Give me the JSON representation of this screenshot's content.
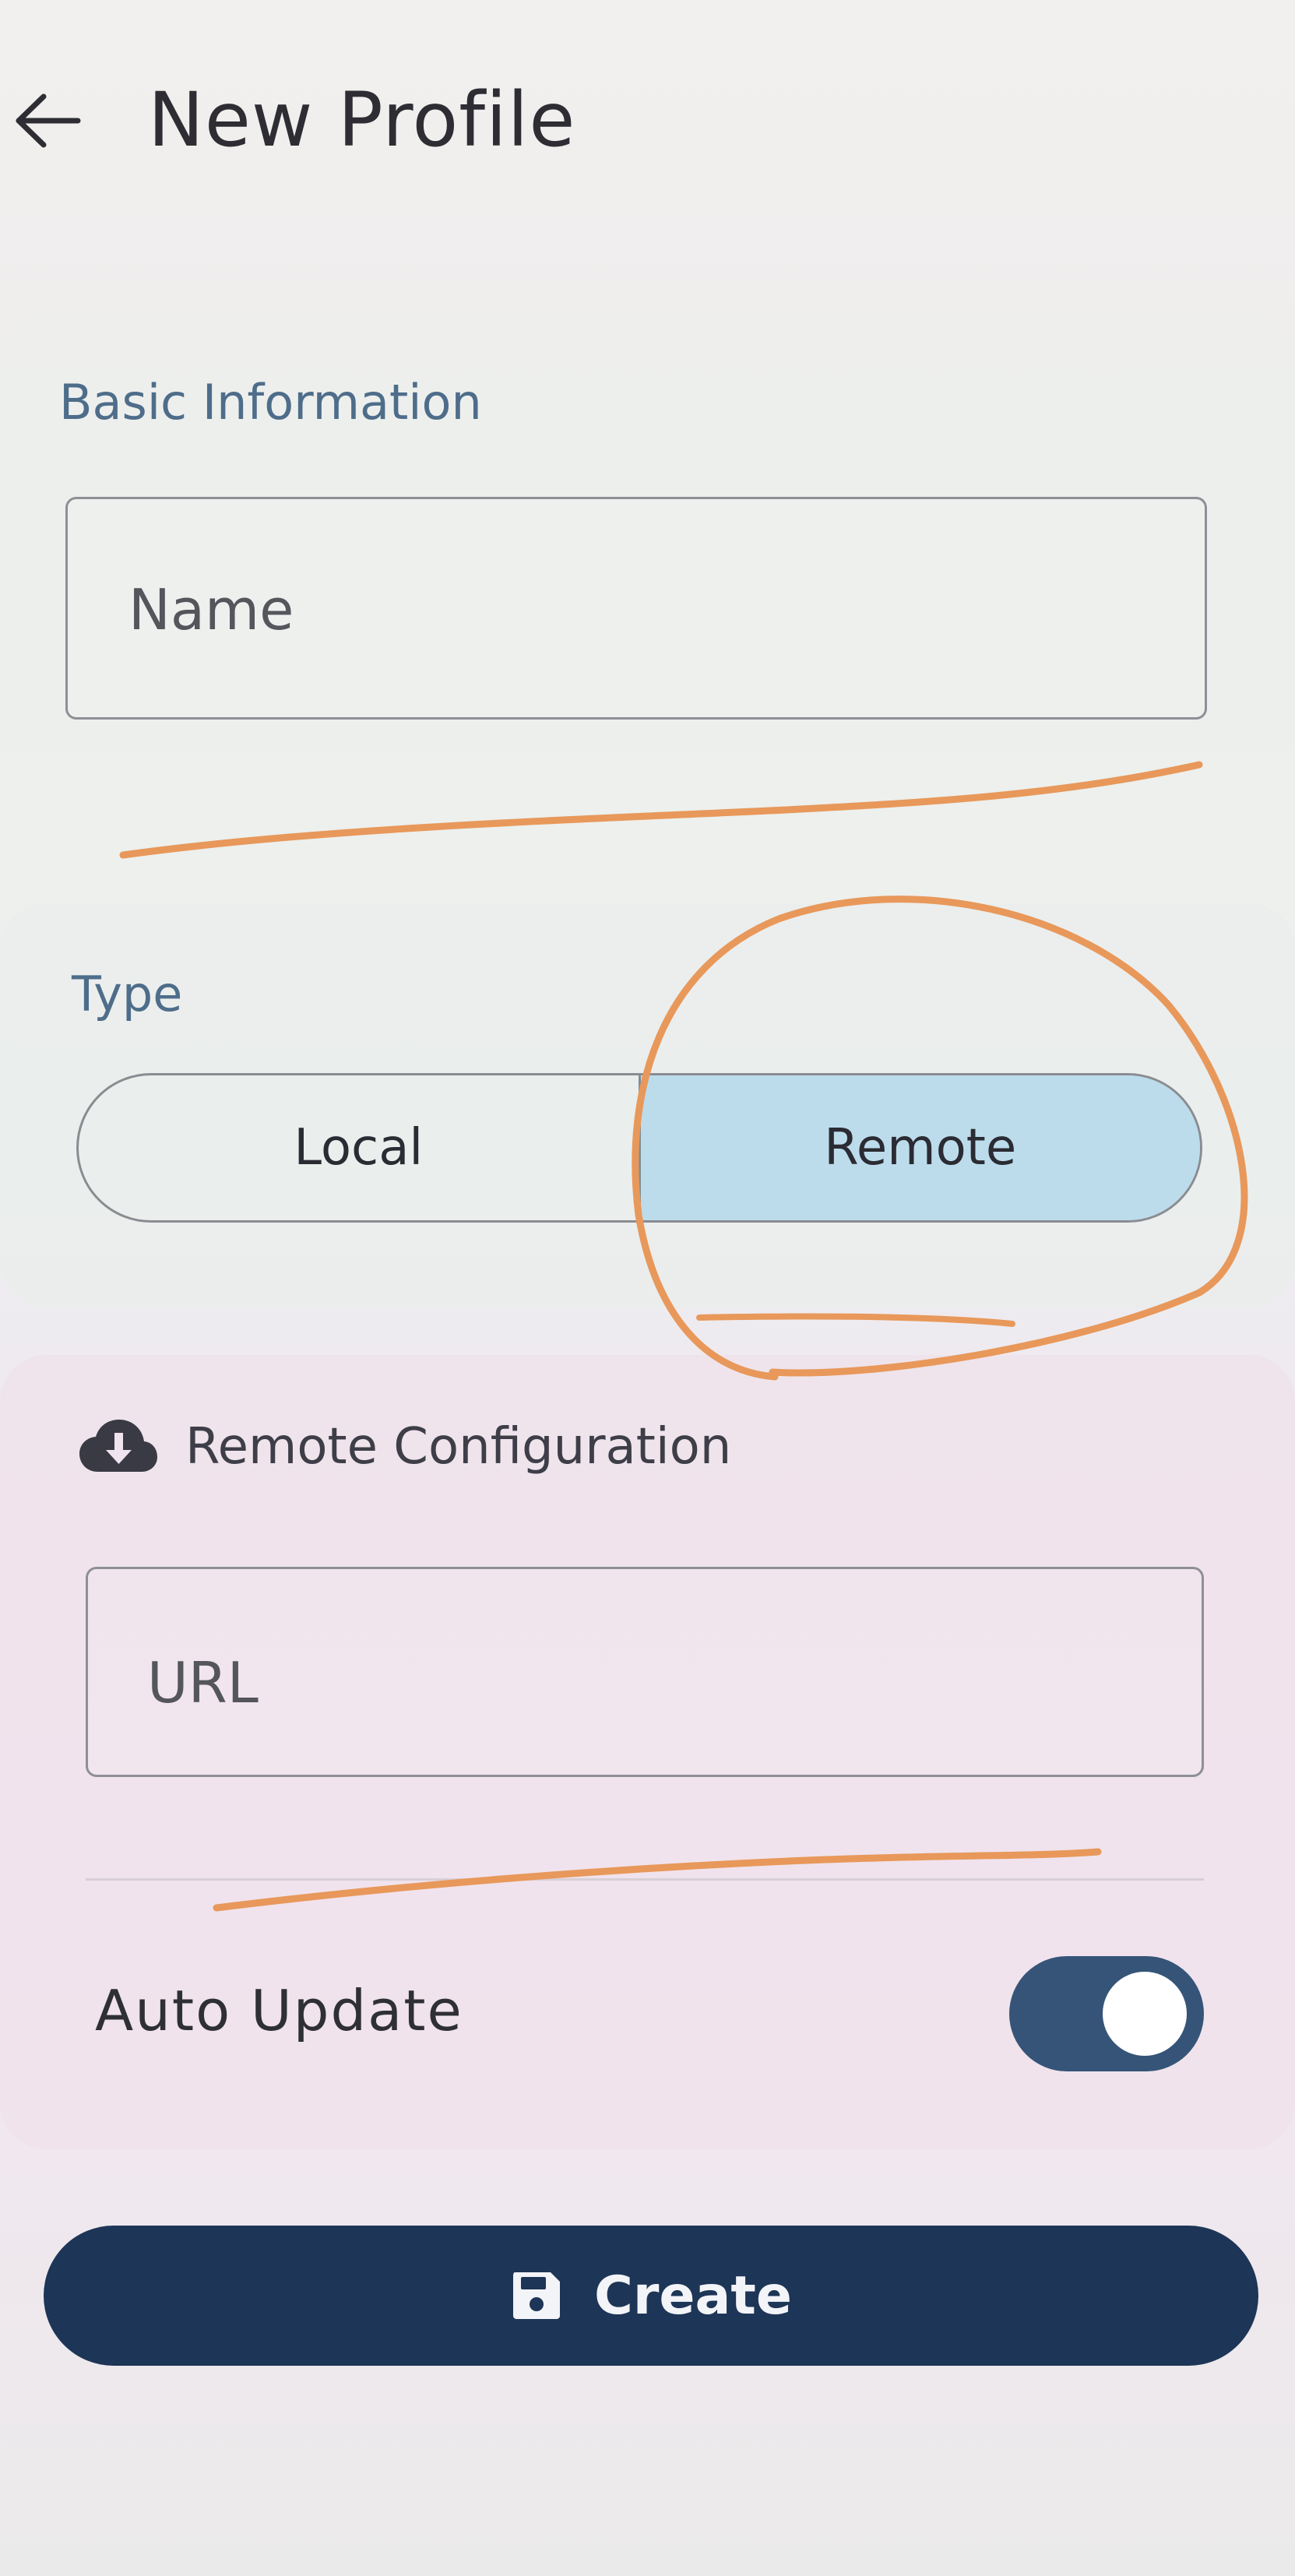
{
  "header": {
    "title": "New Profile",
    "back_icon": "arrow-left-icon"
  },
  "basic_information": {
    "section_label": "Basic Information",
    "name_field": {
      "placeholder": "Name",
      "value": ""
    }
  },
  "type": {
    "section_label": "Type",
    "options": [
      "Local",
      "Remote"
    ],
    "selected": "Remote"
  },
  "remote_configuration": {
    "icon": "cloud-download-icon",
    "title": "Remote Configuration",
    "url_field": {
      "placeholder": "URL",
      "value": ""
    }
  },
  "auto_update": {
    "label": "Auto Update",
    "enabled": true
  },
  "create_button": {
    "icon": "save-icon",
    "label": "Create"
  },
  "colors": {
    "primary": "#1d3556",
    "toggle_on": "#355478",
    "selected_segment": "#bcdcec",
    "section_label": "#4e6d8a",
    "annotation_marker": "#e8985a"
  }
}
